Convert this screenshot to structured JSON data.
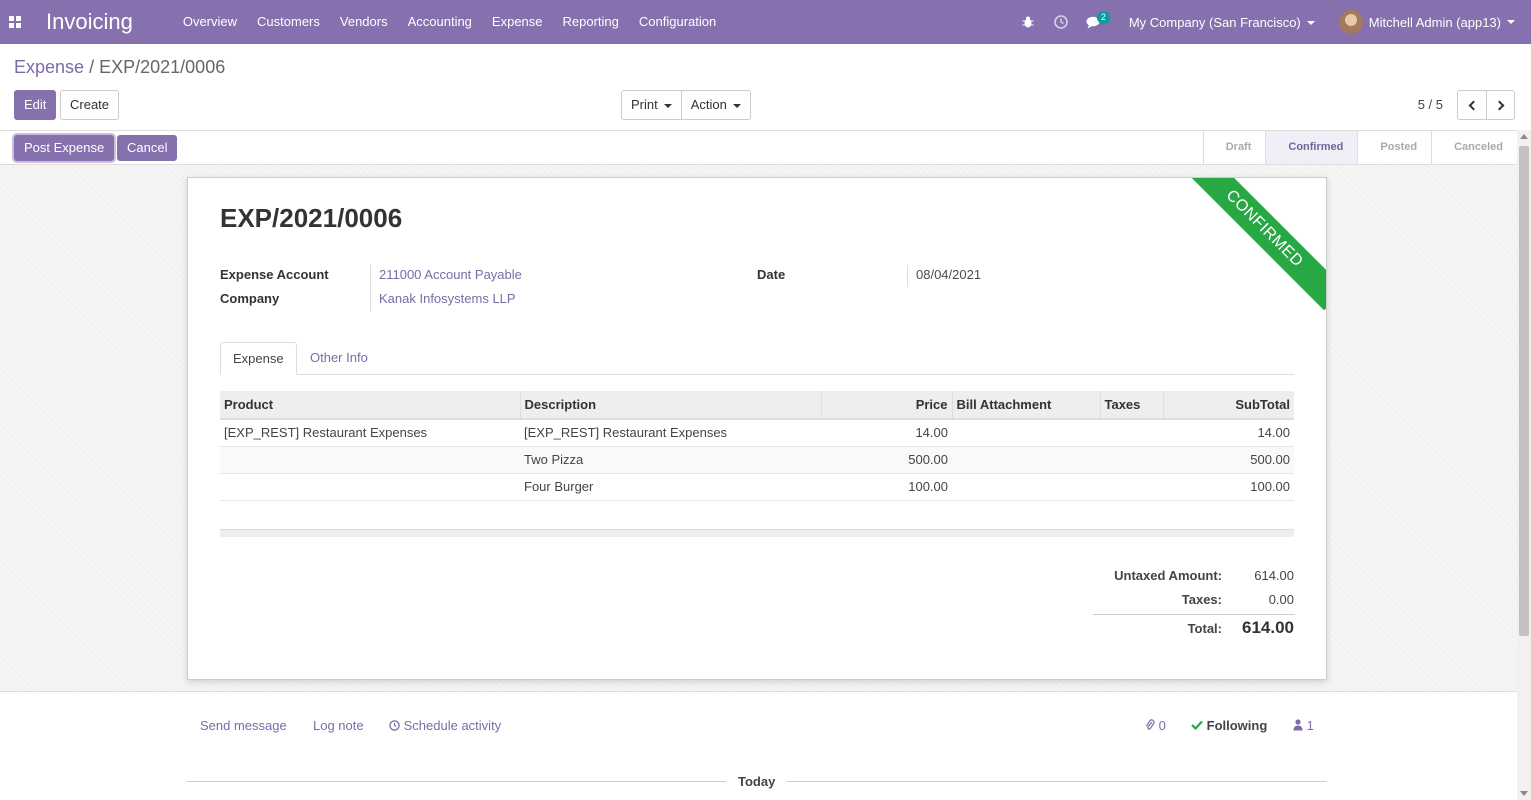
{
  "navbar": {
    "brand": "Invoicing",
    "menu": [
      "Overview",
      "Customers",
      "Vendors",
      "Accounting",
      "Expense",
      "Reporting",
      "Configuration"
    ],
    "messages_count": "2",
    "company": "My Company (San Francisco)",
    "user": "Mitchell Admin (app13)"
  },
  "breadcrumb": {
    "parent": "Expense",
    "separator": "/",
    "current": "EXP/2021/0006"
  },
  "control": {
    "edit": "Edit",
    "create": "Create",
    "print": "Print",
    "action": "Action",
    "pager": "5 / 5"
  },
  "statusbar": {
    "post": "Post Expense",
    "cancel": "Cancel",
    "stages": [
      "Draft",
      "Confirmed",
      "Posted",
      "Canceled"
    ],
    "active_stage": "Confirmed"
  },
  "form": {
    "ribbon": "CONFIRMED",
    "title": "EXP/2021/0006",
    "expense_account_label": "Expense Account",
    "expense_account": "211000 Account Payable",
    "company_label": "Company",
    "company": "Kanak Infosystems LLP",
    "date_label": "Date",
    "date": "08/04/2021",
    "tabs": [
      "Expense",
      "Other Info"
    ]
  },
  "table": {
    "headers": [
      "Product",
      "Description",
      "Price",
      "Bill Attachment",
      "Taxes",
      "SubTotal"
    ],
    "rows": [
      {
        "product": "[EXP_REST] Restaurant Expenses",
        "description": "[EXP_REST] Restaurant Expenses",
        "price": "14.00",
        "attachment": "",
        "taxes": "",
        "subtotal": "14.00"
      },
      {
        "product": "",
        "description": "Two Pizza",
        "price": "500.00",
        "attachment": "",
        "taxes": "",
        "subtotal": "500.00"
      },
      {
        "product": "",
        "description": "Four Burger",
        "price": "100.00",
        "attachment": "",
        "taxes": "",
        "subtotal": "100.00"
      }
    ]
  },
  "totals": {
    "untaxed_label": "Untaxed Amount:",
    "untaxed": "614.00",
    "taxes_label": "Taxes:",
    "taxes": "0.00",
    "total_label": "Total:",
    "total": "614.00"
  },
  "chatter": {
    "send_message": "Send message",
    "log_note": "Log note",
    "schedule_activity": "Schedule activity",
    "attachments": "0",
    "following": "Following",
    "followers": "1",
    "today": "Today"
  },
  "colors": {
    "brand": "#8670ad",
    "ribbon": "#28a745",
    "badge": "#00a09d"
  }
}
